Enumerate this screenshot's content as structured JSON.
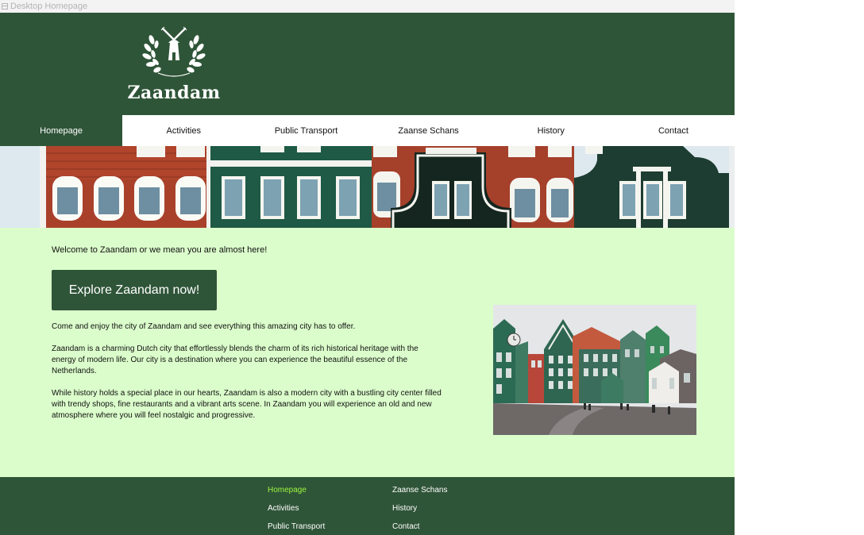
{
  "window": {
    "label": "Desktop Homepage"
  },
  "brand": {
    "name": "Zaandam",
    "header_color": "#2f5538",
    "content_bg": "#dbfdcb",
    "accent_active": "#9cf53f"
  },
  "nav": {
    "items": [
      {
        "label": "Homepage",
        "active": true
      },
      {
        "label": "Activities"
      },
      {
        "label": "Public Transport"
      },
      {
        "label": "Zaanse Schans"
      },
      {
        "label": "History"
      },
      {
        "label": "Contact"
      }
    ]
  },
  "main": {
    "welcome": "Welcome to Zaandam or we mean you are almost here!",
    "cta_label": "Explore Zaandam now!",
    "paragraphs": [
      "Come and enjoy the city of Zaandam and see everything this amazing city has to offer.",
      "Zaandam is a charming Dutch city that effortlessly blends the charm of its rich historical heritage with the energy of modern life. Our city is a destination where you can experience the beautiful essence of the Netherlands.",
      "While history holds a special place in our hearts, Zaandam is also a modern city with a bustling city center filled with trendy shops, fine restaurants and a vibrant arts scene. In Zaandam you will experience an old and new atmosphere where you will feel nostalgic and progressive."
    ]
  },
  "footer": {
    "col1": [
      "Homepage",
      "Activities",
      "Public Transport"
    ],
    "col2": [
      "Zaanse Schans",
      "History",
      "Contact"
    ]
  }
}
